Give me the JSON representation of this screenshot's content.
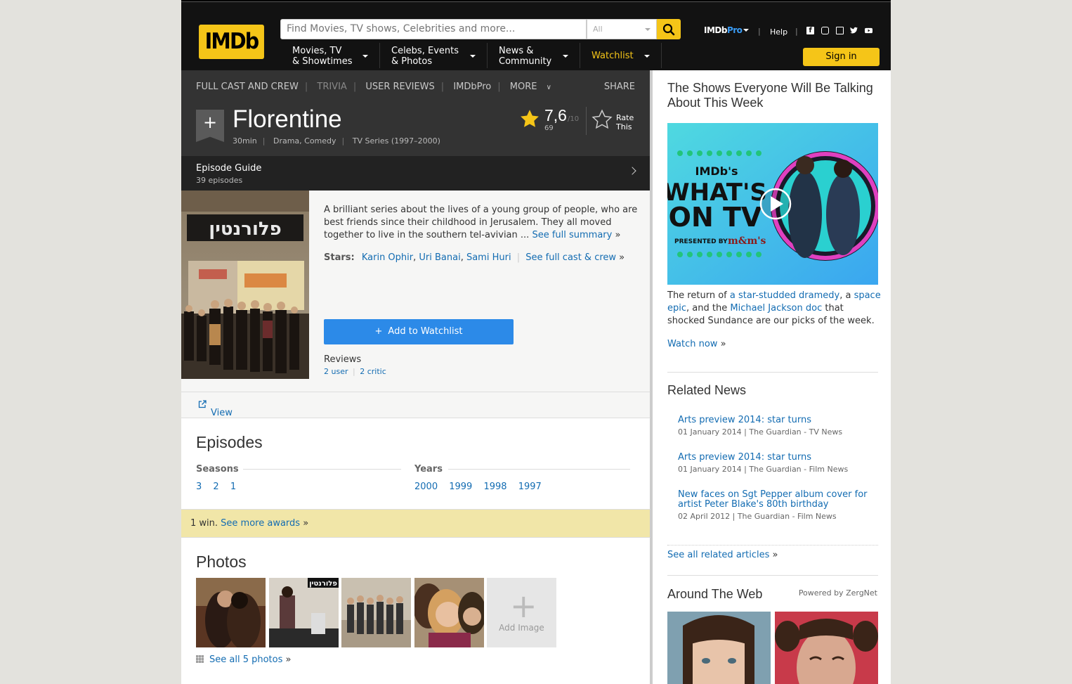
{
  "header": {
    "logo": "IMDb",
    "search_placeholder": "Find Movies, TV shows, Celebrities and more...",
    "search_category": "All",
    "menus": [
      {
        "line1": "Movies, TV",
        "line2": "& Showtimes"
      },
      {
        "line1": "Celebs, Events",
        "line2": "& Photos"
      },
      {
        "line1": "News &",
        "line2": "Community"
      }
    ],
    "watchlist": "Watchlist",
    "pro_logo_a": "IMDb",
    "pro_logo_b": "Pro",
    "help": "Help",
    "sign_in": "Sign in",
    "colors": {
      "brand": "#f5c518",
      "nav_bg": "#121212",
      "link": "#136cb2"
    }
  },
  "subnav": {
    "items": [
      "FULL CAST AND CREW",
      "TRIVIA",
      "USER REVIEWS",
      "IMDbPro",
      "MORE"
    ],
    "share": "SHARE"
  },
  "title_block": {
    "title": "Florentine",
    "runtime": "30min",
    "genres": "Drama, Comedy",
    "type_years": "TV Series (1997–2000)",
    "rating": "7,6",
    "rating_max": "/10",
    "rating_count": "69",
    "rate_line1": "Rate",
    "rate_line2": "This"
  },
  "episode_guide": {
    "title": "Episode Guide",
    "count": "39 episodes"
  },
  "overview": {
    "summary": "A brilliant series about the lives of a young group of people, who are best friends since their childhood in Jerusalem. They all moved together to live in the southern tel-avivian ...",
    "see_summary": "See full summary",
    "poster_text": "פלורנטין",
    "stars_label": "Stars:",
    "stars": [
      "Karin Ophir",
      "Uri Banai",
      "Sami Huri"
    ],
    "see_cast": "See full cast & crew",
    "watchlist_btn": "Add to Watchlist",
    "reviews_label": "Reviews",
    "user_reviews": "2 user",
    "critic_reviews": "2 critic"
  },
  "pro_link": "View production, box office, & company info on IMDbPro",
  "episodes": {
    "title": "Episodes",
    "seasons_label": "Seasons",
    "years_label": "Years",
    "seasons": [
      "3",
      "2",
      "1"
    ],
    "years": [
      "2000",
      "1999",
      "1998",
      "1997"
    ]
  },
  "awards": {
    "text": "1 win.",
    "link": "See more awards"
  },
  "photos": {
    "title": "Photos",
    "add_image": "Add Image",
    "see_all": "See all 5 photos",
    "thumb_text": "פלורנטין"
  },
  "sidebar": {
    "shows_heading": "The Shows Everyone Will Be Talking About This Week",
    "promo": {
      "line1": "IMDb's",
      "line2": "WHAT'S",
      "line3": "ON TV",
      "presented": "PRESENTED BY",
      "sponsor": "m&m's"
    },
    "text_a": "The return of",
    "link_a": "a star-studded dramedy",
    "text_b": ", a",
    "link_b": "space epic",
    "text_c": ", and the",
    "link_c": "Michael Jackson doc",
    "text_d": "that shocked Sundance are our picks of the week.",
    "watch_now": "Watch now",
    "related_heading": "Related News",
    "news": [
      {
        "title": "Arts preview 2014: star turns",
        "meta": "01 January 2014 | The Guardian - TV News"
      },
      {
        "title": "Arts preview 2014: star turns",
        "meta": "01 January 2014 | The Guardian - Film News"
      },
      {
        "title": "New faces on Sgt Pepper album cover for artist Peter Blake's 80th birthday",
        "meta": "02 April 2012 | The Guardian - Film News"
      }
    ],
    "see_related": "See all related articles",
    "web_heading": "Around The Web",
    "powered": "Powered by ZergNet"
  }
}
